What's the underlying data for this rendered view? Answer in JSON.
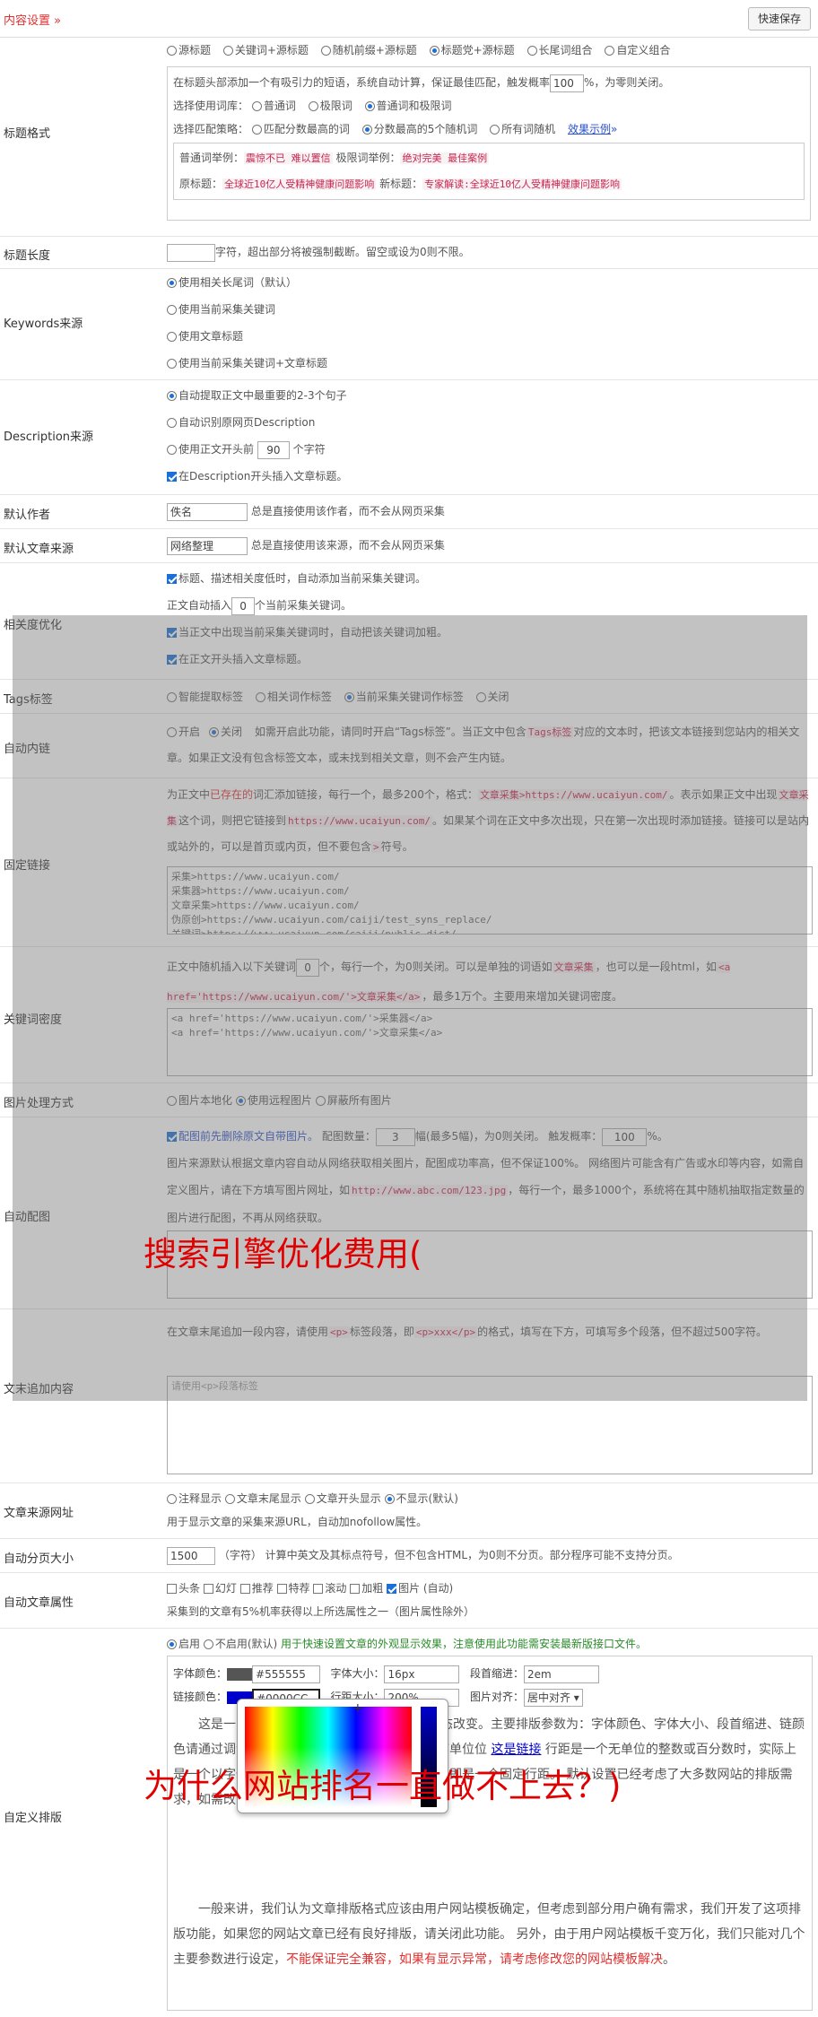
{
  "header": {
    "title": "内容设置",
    "save": "快速保存"
  },
  "rows": {
    "title_format": {
      "label": "标题格式",
      "options": [
        "源标题",
        "关键词+源标题",
        "随机前缀+源标题",
        "标题党+源标题",
        "长尾词组合",
        "自定义组合"
      ],
      "desc1": "在标题头部添加一个有吸引力的短语，系统自动计算，保证最佳匹配，触发概率",
      "prob": "100",
      "desc2": "%，为零则关闭。",
      "lib_label": "选择使用词库：",
      "lib_opts": [
        "普通词",
        "极限词",
        "普通词和极限词"
      ],
      "match_label": "选择匹配策略：",
      "match_opts": [
        "匹配分数最高的词",
        "分数最高的5个随机词",
        "所有词随机"
      ],
      "example_link": "效果示例",
      "ex1_label": "普通词举例：",
      "ex1": "震惊不已 难以置信",
      "ex2_label": "极限词举例：",
      "ex2": "绝对完美 最佳案例",
      "ex3_label": "原标题：",
      "ex3": "全球近10亿人受精神健康问题影响",
      "ex4_label": "新标题：",
      "ex4": "专家解读:全球近10亿人受精神健康问题影响"
    },
    "title_length": {
      "label": "标题长度",
      "hint": "字符，超出部分将被强制截断。留空或设为0则不限。"
    },
    "keywords_src": {
      "label": "Keywords来源",
      "opts": [
        "使用相关长尾词（默认）",
        "使用当前采集关键词",
        "使用文章标题",
        "使用当前采集关键词+文章标题"
      ]
    },
    "desc_src": {
      "label": "Description来源",
      "opts": [
        "自动提取正文中最重要的2-3个句子",
        "自动识别原网页Description"
      ],
      "opt3a": "使用正文开头前",
      "opt3val": "90",
      "opt3b": "个字符",
      "chk": "在Description开头插入文章标题。"
    },
    "author": {
      "label": "默认作者",
      "value": "佚名",
      "hint": "总是直接使用该作者，而不会从网页采集"
    },
    "source": {
      "label": "默认文章来源",
      "value": "网络整理",
      "hint": "总是直接使用该来源，而不会从网页采集"
    },
    "relevance": {
      "label": "相关度优化",
      "c1": "标题、描述相关度低时，自动添加当前采集关键词。",
      "line2a": "正文自动插入",
      "line2v": "0",
      "line2b": "个当前采集关键词。",
      "c3": "当正文中出现当前采集关键词时，自动把该关键词加粗。",
      "c4": "在正文开头插入文章标题。"
    },
    "tags": {
      "label": "Tags标签",
      "opts": [
        "智能提取标签",
        "相关词作标签",
        "当前采集关键词作标签",
        "关闭"
      ]
    },
    "autolink": {
      "label": "自动内链",
      "opts": [
        "开启",
        "关闭"
      ],
      "t1": "如需开启此功能，请同时开启“Tags标签”。当正文中包含",
      "code": "Tags标签",
      "t2": "对应的文本时，把该文本链接到您站内的相关文章。如果正文没有包含标签文本，或未找到相关文章，则不会产生内链。"
    },
    "fixedlink": {
      "label": "固定链接",
      "t1": "为正文中",
      "r1": "已存在的",
      "t2": "词汇添加链接，每行一个，最多200个，格式：",
      "c1": "文章采集>https://www.ucaiyun.com/",
      "t3": "。表示如果正文中出现",
      "c2": "文章采集",
      "t4": "这个词，则把它链接到",
      "c3": "https://www.ucaiyun.com/",
      "t5": "。如果某个词在正文中多次出现，只在第一次出现时添加链接。链接可以是站内或站外的，可以是首页或内页，但不要包含",
      "c4": ">",
      "t6": "符号。",
      "lines": [
        "采集>https://www.ucaiyun.com/",
        "采集器>https://www.ucaiyun.com/",
        "文章采集>https://www.ucaiyun.com/",
        "伪原创>https://www.ucaiyun.com/caiji/test_syns_replace/",
        "关键词>https://www.ucaiyun.com/caiji/public_dict/"
      ]
    },
    "kwdensity": {
      "label": "关键词密度",
      "t1": "正文中随机插入以下关键词",
      "v": "0",
      "t2": "个，每行一个，为0则关闭。可以是单独的词语如",
      "c1": "文章采集",
      "t3": "，也可以是一段html，如",
      "c2": "<a href='https://www.ucaiyun.com/'>文章采集</a>",
      "t4": "，最多1万个。主要用来增加关键词密度。",
      "lines": [
        "<a href='https://www.ucaiyun.com/'>采集器</a>",
        "<a href='https://www.ucaiyun.com/'>文章采集</a>"
      ]
    },
    "imgproc": {
      "label": "图片处理方式",
      "opts": [
        "图片本地化",
        "使用远程图片",
        "屏蔽所有图片"
      ]
    },
    "autoimg": {
      "label": "自动配图",
      "c1": "配图前先删除原文自带图片。",
      "t1": "配图数量：",
      "v1": "3",
      "t2": "幅(最多5幅)，为0则关闭。 触发概率：",
      "v2": "100",
      "t3": "%。",
      "t4": "图片来源默认根据文章内容自动从网络获取相关图片，配图成功率高，但不保证100%。 网络图片可能含有广告或水印等内容，如需自定义图片，请在下方填写图片网址，如",
      "c": "http://www.abc.com/123.jpg",
      "t5": "，每行一个，最多1000个，系统将在其中随机抽取指定数量的图片进行配图，不再从网络获取。"
    },
    "tailcontent": {
      "label": "文末追加内容",
      "t1": "在文章末尾追加一段内容，请使用",
      "c1": "<p>",
      "t2": "标签段落，即",
      "c2": "<p>xxx</p>",
      "t3": "的格式，填写在下方，可填写多个段落，但不超过500字符。",
      "placeholder": "请使用<p>段落标签"
    },
    "srcurl": {
      "label": "文章来源网址",
      "opts": [
        "注释显示",
        "文章末尾显示",
        "文章开头显示",
        "不显示(默认)"
      ],
      "hint": "用于显示文章的采集来源URL，自动加nofollow属性。"
    },
    "paging": {
      "label": "自动分页大小",
      "v": "1500",
      "hint": "（字符） 计算中英文及其标点符号，但不包含HTML，为0则不分页。部分程序可能不支持分页。"
    },
    "attrs": {
      "label": "自动文章属性",
      "opts": [
        "头条",
        "幻灯",
        "推荐",
        "特荐",
        "滚动",
        "加粗",
        "图片 (自动)"
      ],
      "hint": "采集到的文章有5%机率获得以上所选属性之一（图片属性除外）"
    },
    "layout": {
      "label": "自定义排版",
      "opts": [
        "启用",
        "不启用(默认)"
      ],
      "green": "用于快速设置文章的外观显示效果，注意使用此功能需安装最新版接口文件。",
      "fc_label": "字体颜色：",
      "fc": "#555555",
      "fs_label": "字体大小：",
      "fs": "16px",
      "ind_label": "段首缩进：",
      "ind": "2em",
      "lc_label": "链接颜色：",
      "lc": "#0000CC",
      "lh_label": "行距大小：",
      "lh": "200%",
      "ia_label": "图片对齐：",
      "ia": "居中对齐",
      "p1a": "这是一",
      "p1b": "置动态改变。主要排版参数为：字体颜色、字体大小、段首缩进、链",
      "p1c": "颜色请通过调色板进行选择，字体大小和缩进需要带单位",
      "p1d": "位",
      "p1e": "行距是一个无单位的整数或百分数时，实际上是一个以字体大小为基数的行距倍数；有单位时，即是一个固定行距。 默认设置已经考虑了大多数网站的排版需求，如需改动，可根据本段落自行确认排版效果。",
      "link_text": "这是链接",
      "p2": "一般来讲，我们认为文章排版格式应该由用户网站模板确定，但考虑到部分用户确有需求，我们开发了这项排版功能，如果您的网站文章已经有良好排版，请关闭此功能。 另外，由于用户网站模板千变万化，我们只能对几个主要参数进行设定，",
      "p2red": "不能保证完全兼容，如果有显示异常，请考虑修改您的网站模板解决",
      "p2end": "。"
    }
  },
  "overlay": {
    "text1": "搜索引擎优化费用(",
    "text2": "为什么网站排名一直做不上去？)"
  },
  "colors": {
    "accent": "#e03030",
    "link": "#0000CC",
    "font": "#555555"
  }
}
